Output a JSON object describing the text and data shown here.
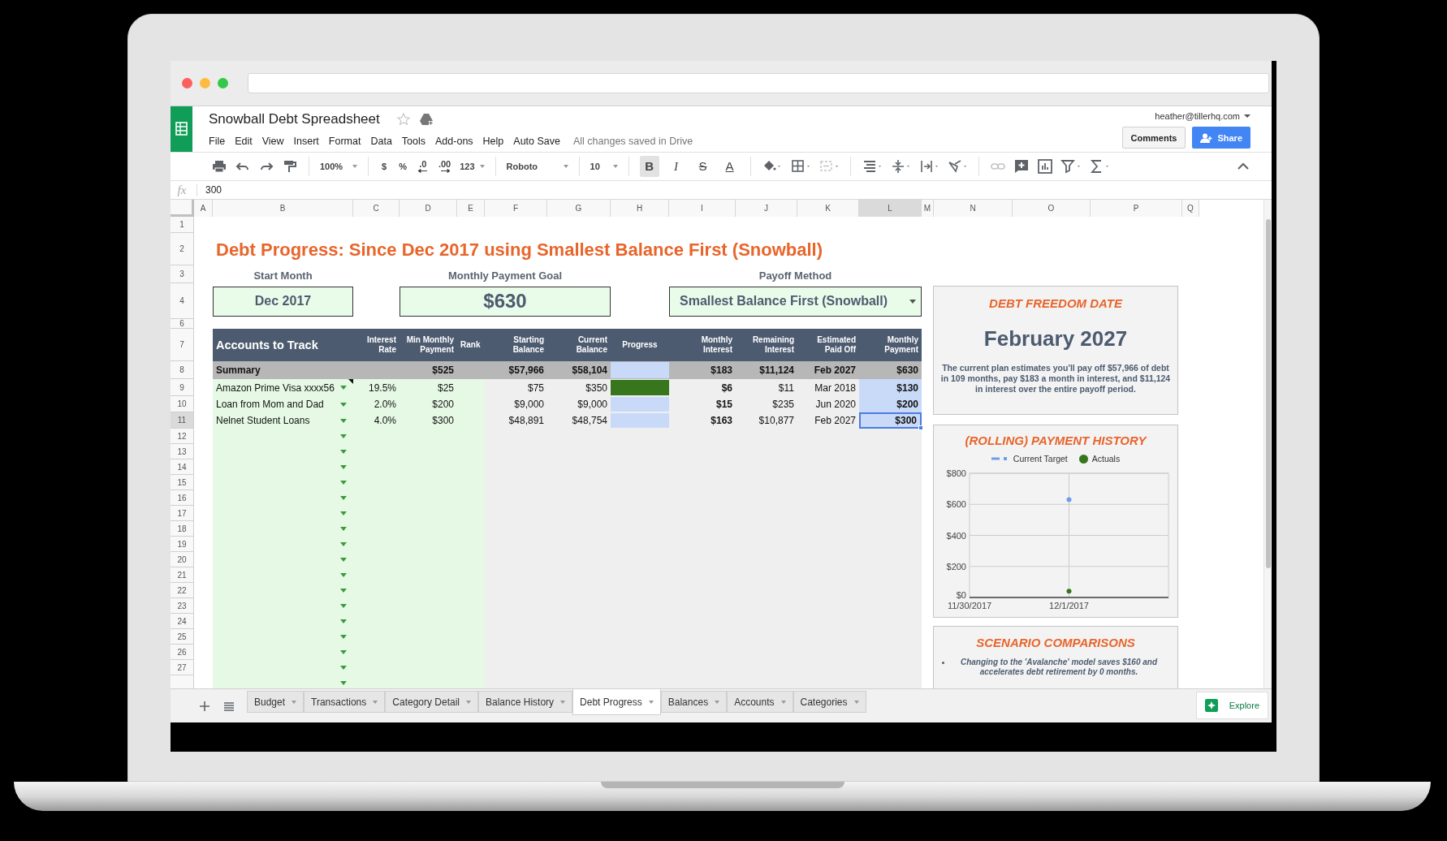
{
  "app": {
    "title": "Snowball Debt Spreadsheet",
    "menus": [
      "File",
      "Edit",
      "View",
      "Insert",
      "Format",
      "Data",
      "Tools",
      "Add-ons",
      "Help",
      "Auto Save"
    ],
    "save_status": "All changes saved in Drive",
    "account": "heather@tillerhq.com",
    "buttons": [
      {
        "label": "Comments",
        "kind": "plain"
      },
      {
        "label": "Share",
        "kind": "primary"
      }
    ]
  },
  "toolbar": {
    "zoom": "100%",
    "currency": "$",
    "percent": "%",
    "decrease_decimals": ".0",
    "increase_decimals": ".00",
    "number_format": "123",
    "font": "Roboto",
    "font_size": "10",
    "format_buttons": [
      {
        "label": "B",
        "on": true
      },
      {
        "label": "I",
        "on": false
      },
      {
        "label": "S",
        "on": false
      },
      {
        "label": "A",
        "on": false
      }
    ]
  },
  "formula_bar": {
    "label": "fx",
    "value": "300"
  },
  "columns": [
    {
      "label": "A",
      "selected": false
    },
    {
      "label": "B",
      "selected": false
    },
    {
      "label": "C",
      "selected": false
    },
    {
      "label": "D",
      "selected": false
    },
    {
      "label": "E",
      "selected": false
    },
    {
      "label": "F",
      "selected": false
    },
    {
      "label": "G",
      "selected": false
    },
    {
      "label": "H",
      "selected": false
    },
    {
      "label": "I",
      "selected": false
    },
    {
      "label": "J",
      "selected": false
    },
    {
      "label": "K",
      "selected": false
    },
    {
      "label": "L",
      "selected": true
    },
    {
      "label": "M",
      "selected": false
    },
    {
      "label": "N",
      "selected": false
    },
    {
      "label": "O",
      "selected": false
    },
    {
      "label": "P",
      "selected": false
    },
    {
      "label": "Q",
      "selected": false
    }
  ],
  "rows": [
    {
      "label": "1",
      "selected": false
    },
    {
      "label": "2",
      "selected": false
    },
    {
      "label": "3",
      "selected": false
    },
    {
      "label": "4",
      "selected": false
    },
    {
      "label": "6",
      "selected": false
    },
    {
      "label": "7",
      "selected": false
    },
    {
      "label": "8",
      "selected": false
    },
    {
      "label": "9",
      "selected": false
    },
    {
      "label": "10",
      "selected": false
    },
    {
      "label": "11",
      "selected": true
    },
    {
      "label": "12",
      "selected": false
    },
    {
      "label": "13",
      "selected": false
    },
    {
      "label": "14",
      "selected": false
    },
    {
      "label": "15",
      "selected": false
    },
    {
      "label": "16",
      "selected": false
    },
    {
      "label": "17",
      "selected": false
    },
    {
      "label": "18",
      "selected": false
    },
    {
      "label": "19",
      "selected": false
    },
    {
      "label": "20",
      "selected": false
    },
    {
      "label": "21",
      "selected": false
    },
    {
      "label": "22",
      "selected": false
    },
    {
      "label": "23",
      "selected": false
    },
    {
      "label": "24",
      "selected": false
    },
    {
      "label": "25",
      "selected": false
    },
    {
      "label": "26",
      "selected": false
    },
    {
      "label": "27",
      "selected": false
    }
  ],
  "sheet": {
    "title": "Debt Progress: Since Dec 2017 using Smallest Balance First (Snowball)",
    "inputs": [
      {
        "label": "Start Month",
        "value": "Dec 2017",
        "kind": "date"
      },
      {
        "label": "Monthly Payment Goal",
        "value": "$630",
        "kind": "currency"
      },
      {
        "label": "Payoff Method",
        "value": "Smallest Balance First (Snowball)",
        "kind": "select"
      }
    ],
    "table": {
      "columns": [
        {
          "label": "Accounts to Track"
        },
        {
          "label": "Interest\nRate"
        },
        {
          "label": "Min Monthly\nPayment"
        },
        {
          "label": "Rank"
        },
        {
          "label": "Starting\nBalance"
        },
        {
          "label": "Current\nBalance"
        },
        {
          "label": "Progress"
        },
        {
          "label": "Monthly\nInterest"
        },
        {
          "label": "Remaining\nInterest"
        },
        {
          "label": "Estimated\nPaid Off"
        },
        {
          "label": "Monthly\nPayment"
        }
      ],
      "summary": {
        "name": "Summary",
        "min_payment": "$525",
        "starting": "$57,966",
        "current": "$58,104",
        "progress": {
          "level": 0
        },
        "monthly_interest": "$183",
        "remaining_interest": "$11,124",
        "paid_off": "Feb 2027",
        "monthly_payment": "$630"
      },
      "accounts": [
        {
          "name": "Amazon Prime Visa xxxx56",
          "has_note": true,
          "rate": "19.5%",
          "min_payment": "$25",
          "starting": "$75",
          "current": "$350",
          "progress": {
            "level": 1
          },
          "monthly_interest": "$6",
          "remaining_interest": "$11",
          "paid_off": "Mar 2018",
          "monthly_payment": "$130",
          "payment_selected": false
        },
        {
          "name": "Loan from Mom and Dad",
          "has_note": false,
          "rate": "2.0%",
          "min_payment": "$200",
          "starting": "$9,000",
          "current": "$9,000",
          "progress": {
            "level": 0
          },
          "monthly_interest": "$15",
          "remaining_interest": "$235",
          "paid_off": "Jun 2020",
          "monthly_payment": "$200",
          "payment_selected": false
        },
        {
          "name": "Nelnet Student Loans",
          "has_note": false,
          "rate": "4.0%",
          "min_payment": "$300",
          "starting": "$48,891",
          "current": "$48,754",
          "progress": {
            "level": 0
          },
          "monthly_interest": "$163",
          "remaining_interest": "$10,877",
          "paid_off": "Feb 2027",
          "monthly_payment": "$300",
          "payment_selected": true
        }
      ]
    }
  },
  "panels": {
    "freedom": {
      "title": "DEBT FREEDOM DATE",
      "date": "February 2027",
      "text": "The current plan estimates you'll pay off $57,966 of debt in 109 months, pay $183 a month in interest, and $11,124 in interest over the entire payoff period."
    },
    "history": {
      "chart_data": {
        "type": "line",
        "title": "(ROLLING) PAYMENT HISTORY",
        "categories": [
          "11/30/2017",
          "12/1/2017",
          null
        ],
        "grid": true,
        "series": [
          {
            "name": "Current Target",
            "color": "#6d9eeb",
            "marker": "circle",
            "values": [
              null,
              630,
              null
            ]
          },
          {
            "name": "Actuals",
            "color": "#38761d",
            "marker": "circle",
            "values": [
              null,
              40,
              null
            ]
          }
        ],
        "ylim": [
          0,
          800
        ],
        "yticks": [
          {
            "value": 0,
            "label": "$0"
          },
          {
            "value": 200,
            "label": "$200"
          },
          {
            "value": 400,
            "label": "$400"
          },
          {
            "value": 600,
            "label": "$600"
          },
          {
            "value": 800,
            "label": "$800"
          }
        ]
      }
    },
    "scenarios": {
      "title": "SCENARIO COMPARISONS",
      "items": [
        "Changing to the 'Avalanche' model saves $160 and accelerates debt retirement by 0 months."
      ]
    }
  },
  "sheet_tabs": [
    {
      "label": "Budget",
      "selected": false
    },
    {
      "label": "Transactions",
      "selected": false
    },
    {
      "label": "Category Detail",
      "selected": false
    },
    {
      "label": "Balance History",
      "selected": false
    },
    {
      "label": "Debt Progress",
      "selected": true
    },
    {
      "label": "Balances",
      "selected": false
    },
    {
      "label": "Accounts",
      "selected": false
    },
    {
      "label": "Categories",
      "selected": false
    }
  ],
  "explore": "Explore"
}
